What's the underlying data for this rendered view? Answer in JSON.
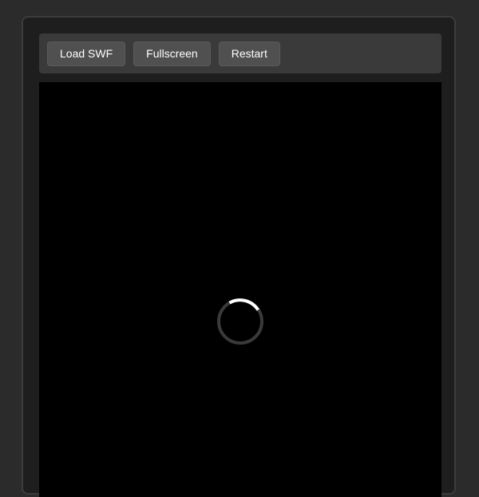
{
  "toolbar": {
    "buttons": [
      {
        "label": "Load SWF"
      },
      {
        "label": "Fullscreen"
      },
      {
        "label": "Restart"
      }
    ]
  },
  "player": {
    "state": "loading",
    "spinner_icon": "loading-spinner-icon"
  },
  "colors": {
    "page_background": "#2b2b2b",
    "panel_background": "#1e1e1e",
    "toolbar_background": "#3a3a3a",
    "button_background": "#505050",
    "stage_background": "#000000",
    "spinner_track": "#3a3a3a",
    "spinner_arc": "#ffffff"
  }
}
